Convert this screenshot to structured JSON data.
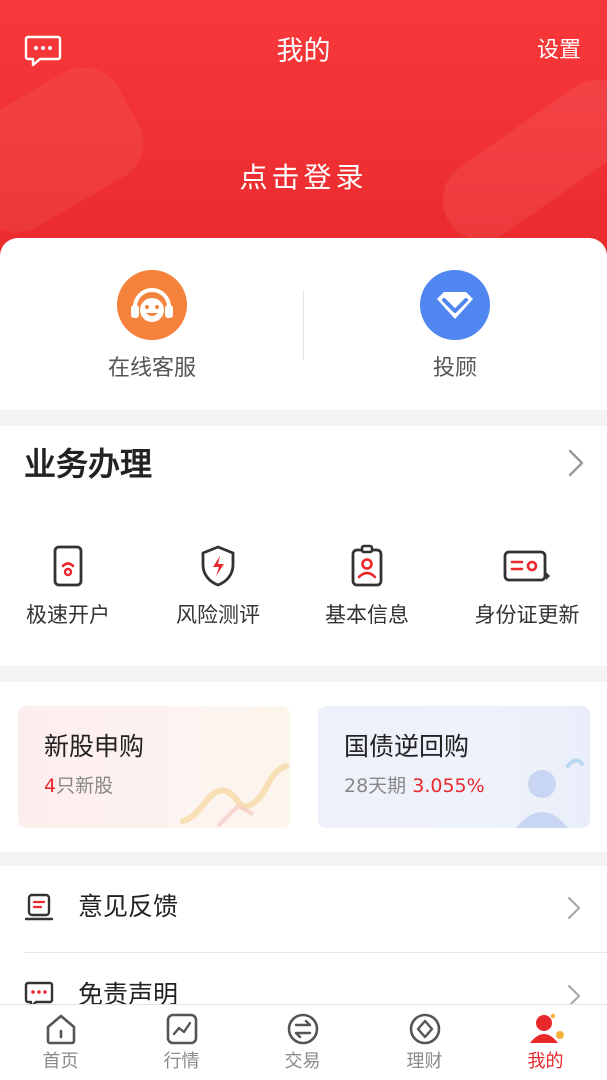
{
  "header": {
    "title": "我的",
    "settings_label": "设置",
    "login_label": "点击登录",
    "message_icon": "message-icon"
  },
  "services": [
    {
      "label": "在线客服",
      "icon": "headset-face-icon",
      "color": "#f5823b"
    },
    {
      "label": "投顾",
      "icon": "diamond-icon",
      "color": "#4f86ef"
    }
  ],
  "business": {
    "title": "业务办理",
    "items": [
      {
        "label": "极速开户",
        "icon": "phone-account-icon"
      },
      {
        "label": "风险测评",
        "icon": "shield-bolt-icon"
      },
      {
        "label": "基本信息",
        "icon": "id-badge-icon"
      },
      {
        "label": "身份证更新",
        "icon": "id-card-icon"
      }
    ]
  },
  "promos": [
    {
      "title": "新股申购",
      "count": "4",
      "sub": "只新股"
    },
    {
      "title": "国债逆回购",
      "sub": "28天期",
      "rate": "3.055%"
    }
  ],
  "list": [
    {
      "label": "意见反馈",
      "icon": "feedback-icon"
    },
    {
      "label": "免责声明",
      "icon": "disclaimer-icon"
    }
  ],
  "tabs": [
    {
      "label": "首页",
      "icon": "home-icon"
    },
    {
      "label": "行情",
      "icon": "market-chart-icon"
    },
    {
      "label": "交易",
      "icon": "exchange-icon"
    },
    {
      "label": "理财",
      "icon": "wealth-icon"
    },
    {
      "label": "我的",
      "icon": "user-icon",
      "active": true
    }
  ],
  "colors": {
    "brand_red": "#e8282b",
    "orange": "#f5823b",
    "blue": "#4f86ef"
  }
}
